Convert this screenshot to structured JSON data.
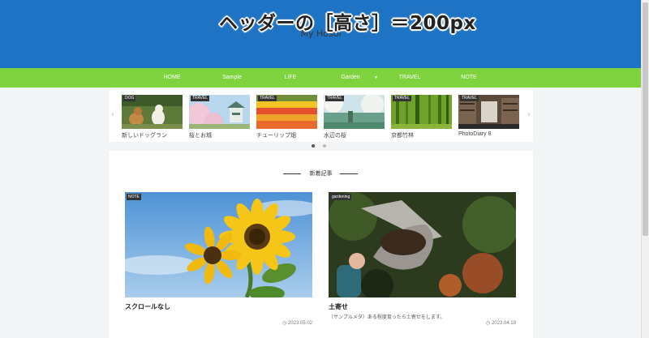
{
  "header": {
    "site_title": "My Hosoi",
    "overlay_note": "ヘッダーの［高さ］＝200px"
  },
  "nav": {
    "items": [
      {
        "label": "HOME"
      },
      {
        "label": "Sample"
      },
      {
        "label": "LIFE"
      },
      {
        "label": "Garden"
      },
      {
        "label": "TRAVEL"
      },
      {
        "label": "NOTE"
      }
    ],
    "garden_chevron": "▾"
  },
  "slider": {
    "prev_arrow": "‹",
    "next_arrow": "›",
    "slides": [
      {
        "category": "DOG",
        "title": "新しいドッグラン"
      },
      {
        "category": "TRAVEL",
        "title": "桜とお城"
      },
      {
        "category": "TRAVEL",
        "title": "チューリップ畑"
      },
      {
        "category": "TRAVEL",
        "title": "水辺の桜"
      },
      {
        "category": "TRAVEL",
        "title": "京都竹林"
      },
      {
        "category": "TRAVEL",
        "title": "PhotoDiary 8"
      }
    ],
    "active_dot": 0,
    "dot_count": 2
  },
  "section": {
    "title": "新着記事"
  },
  "posts": [
    {
      "category": "NOTE",
      "title": "スクロールなし",
      "excerpt": "",
      "date": "2023.05.02"
    },
    {
      "category": "gardening",
      "title": "土寄せ",
      "excerpt": "（サンプルメタ）ある程度育ったら土寄せをします。",
      "date": "2023.04.19"
    }
  ],
  "icons": {
    "clock": "◷"
  },
  "colors": {
    "header_bg": "#1f73c4",
    "nav_bg": "#7ed33e",
    "page_bg": "#f3f4f5"
  }
}
